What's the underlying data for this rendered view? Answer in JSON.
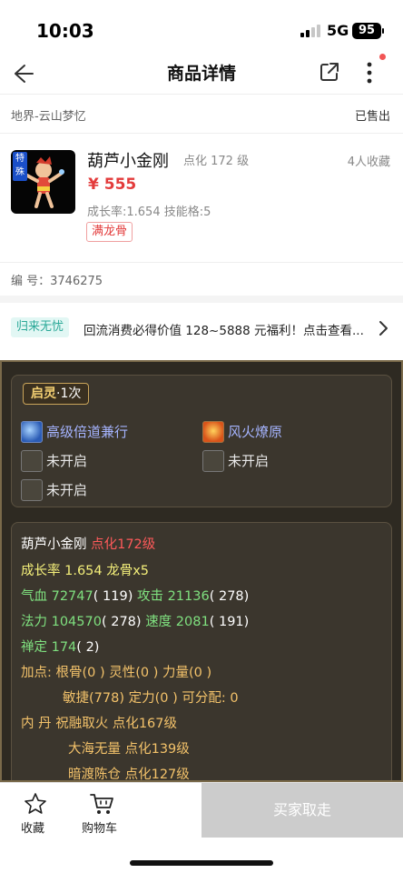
{
  "status_bar": {
    "time": "10:03",
    "network": "5G",
    "battery": "95"
  },
  "nav": {
    "title": "商品详情"
  },
  "server": {
    "name": "地界-云山梦忆",
    "status": "已售出"
  },
  "product": {
    "special_badge": "特殊",
    "name": "葫芦小金刚",
    "level": "点化 172 级",
    "favorites": "4人收藏",
    "price": "¥ 555",
    "stats": "成长率:1.654 技能格:5",
    "tag": "满龙骨",
    "serial": "编 号：3746275"
  },
  "promo": {
    "tag": "归来无忧",
    "text": "回流消费必得价值 128~5888 元福利！点击查看..."
  },
  "spirit": {
    "title": "启灵",
    "count": "·1次",
    "skills": [
      {
        "label": "高级倍道兼行",
        "icon": "speed-skill-icon"
      },
      {
        "label": "风火燎原",
        "icon": "fire-skill-icon"
      },
      {
        "label": "未开启",
        "icon": "locked-skill-icon"
      },
      {
        "label": "未开启",
        "icon": "locked-skill-icon"
      },
      {
        "label": "未开启",
        "icon": "locked-skill-icon"
      }
    ]
  },
  "pet": {
    "name": "葫芦小金刚",
    "level": "点化172级",
    "growth": "成长率 1.654 龙骨x5",
    "hp_label": "气血",
    "hp_value": "72747",
    "hp_extra": "( 119)",
    "atk_label": "攻击",
    "atk_value": "21136",
    "atk_extra": "( 278)",
    "mp_label": "法力",
    "mp_value": "104570",
    "mp_extra": "( 278)",
    "spd_label": "速度",
    "spd_value": "2081",
    "spd_extra": "( 191)",
    "focus_label": "禅定",
    "focus_value": "174",
    "focus_extra": "( 2)",
    "points_line1": "加点:  根骨(0 ) 灵性(0 ) 力量(0 )",
    "points_line2": "敏捷(778) 定力(0 ) 可分配:  0",
    "neidan_label": "内    丹",
    "neidan_1": "祝融取火 点化167级",
    "neidan_2": "大海无量 点化139级",
    "neidan_3": "暗渡陈仓 点化127级"
  },
  "bottom": {
    "favorite": "收藏",
    "cart": "购物车",
    "buy": "买家取走"
  },
  "colors": {
    "price_red": "#e33b3b",
    "disabled_gray": "#cccccc",
    "promo_teal": "#2aa897",
    "panel_bg": "#2e2a22"
  }
}
